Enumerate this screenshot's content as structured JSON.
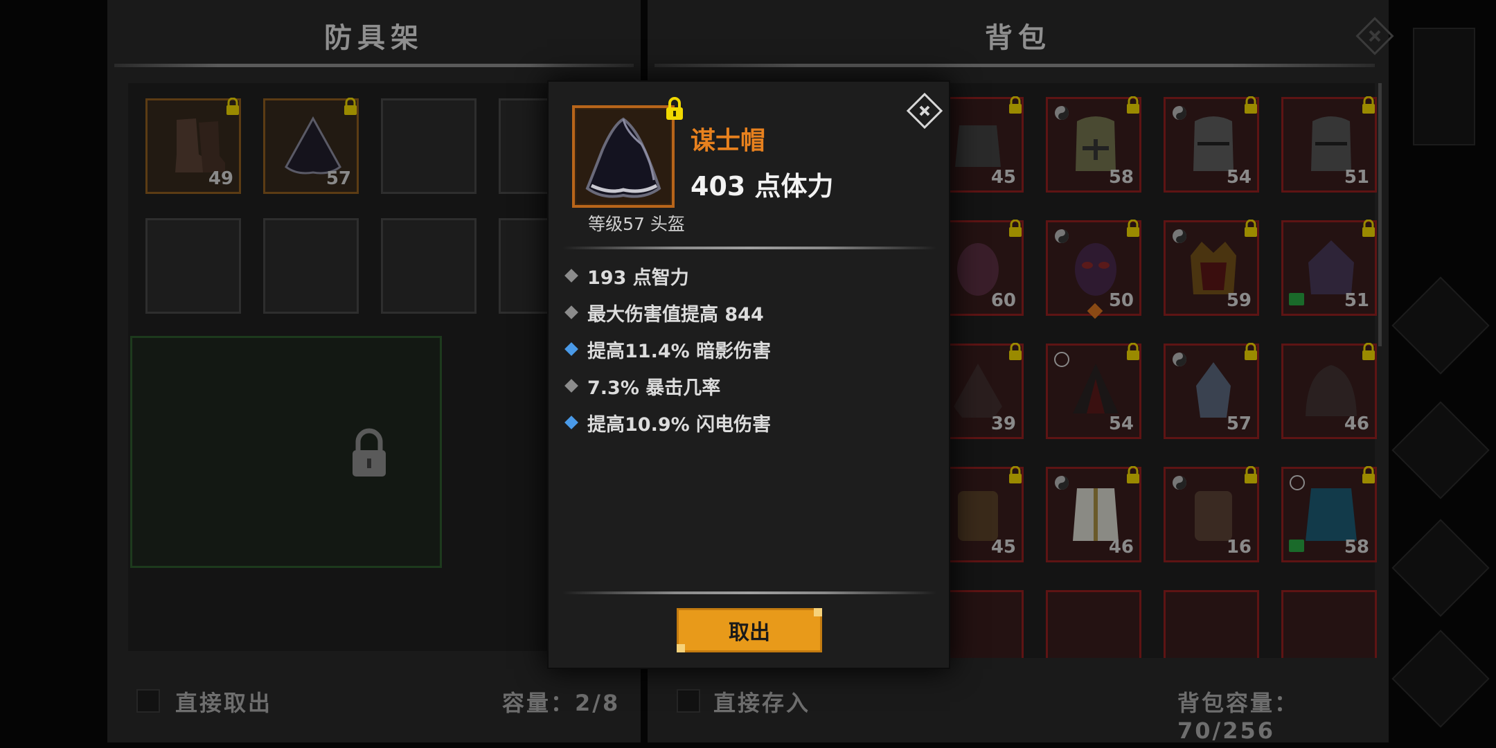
{
  "armor_rack": {
    "title": "防具架",
    "items": [
      {
        "level": "49"
      },
      {
        "level": "57"
      }
    ],
    "direct_take_label": "直接取出",
    "capacity_label": "容量：2/8"
  },
  "backpack": {
    "title": "背包",
    "direct_store_label": "直接存入",
    "capacity_label": "背包容量：70/256",
    "items": [
      {
        "level": "45"
      },
      {
        "level": "58"
      },
      {
        "level": "54"
      },
      {
        "level": "51"
      },
      {
        "level": "60"
      },
      {
        "level": "50"
      },
      {
        "level": "59"
      },
      {
        "level": "51"
      },
      {
        "level": "39"
      },
      {
        "level": "54"
      },
      {
        "level": "57"
      },
      {
        "level": "46"
      },
      {
        "level": "45"
      },
      {
        "level": "46"
      },
      {
        "level": "16"
      },
      {
        "level": "58"
      }
    ]
  },
  "tooltip": {
    "item_name": "谋士帽",
    "main_stat": "403 点体力",
    "level_type": "等级57 头盔",
    "stats": [
      {
        "text": "193 点智力",
        "bullet": "grey"
      },
      {
        "text": "最大伤害值提高 844",
        "bullet": "grey"
      },
      {
        "text": "提高11.4% 暗影伤害",
        "bullet": "blue"
      },
      {
        "text": "7.3% 暴击几率",
        "bullet": "grey"
      },
      {
        "text": "提高10.9% 闪电伤害",
        "bullet": "blue"
      }
    ],
    "take_out_label": "取出"
  },
  "colors": {
    "accent_orange": "#e8811e",
    "button_orange": "#e89a1a",
    "lock_yellow": "#f0d800",
    "blue_bullet": "#4a9ae8"
  },
  "icons": [
    "lock-icon",
    "close-icon",
    "yin-yang-icon",
    "hood-helmet-icon"
  ]
}
